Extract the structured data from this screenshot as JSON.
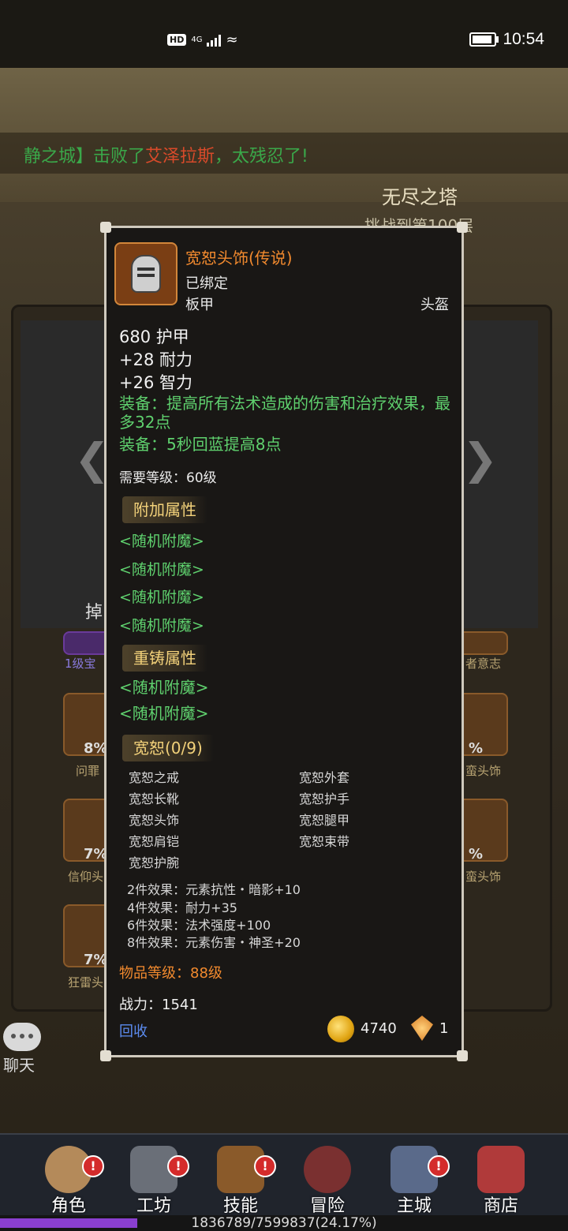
{
  "status_bar": {
    "time": "10:54",
    "hd": "HD",
    "network": "4G"
  },
  "background": {
    "ticker_prefix": "静之城】击败了",
    "ticker_name": "艾泽拉斯",
    "ticker_suffix": "，太残忍了!",
    "tower_title": "无尽之塔",
    "tower_sub": "挑战到第100层",
    "drop_tab": "掉",
    "left_slots": [
      "1级宝",
      "问罪",
      "信仰头",
      "狂雷头"
    ],
    "left_pcts": [
      "8%",
      "7%",
      "7%"
    ],
    "right_slots": [
      "者意志",
      "蛮头饰",
      "蛮头饰"
    ],
    "right_pcts": [
      "%",
      "%"
    ]
  },
  "chat": {
    "label": "聊天"
  },
  "item": {
    "name": "宽恕头饰(传说)",
    "bound": "已绑定",
    "armor_type": "板甲",
    "slot": "头盔",
    "stats": [
      "680 护甲",
      "+28 耐力",
      "+26 智力"
    ],
    "equip_effects": [
      "装备：提高所有法术造成的伤害和治疗效果，最多32点",
      "装备：5秒回蓝提高8点"
    ],
    "required_level": "需要等级：60级",
    "extra_attr_title": "附加属性",
    "extra_attrs": [
      "<随机附魔>",
      "<随机附魔>",
      "<随机附魔>",
      "<随机附魔>"
    ],
    "reforge_title": "重铸属性",
    "reforge_attrs": [
      "<随机附魔>",
      "<随机附魔>"
    ],
    "set_title": "宽恕(0/9)",
    "set_items_left": [
      "宽恕之戒",
      "宽恕长靴",
      "宽恕头饰",
      "宽恕肩铠",
      "宽恕护腕"
    ],
    "set_items_right": [
      "宽恕外套",
      "宽恕护手",
      "宽恕腿甲",
      "宽恕束带"
    ],
    "set_bonuses": [
      "2件效果：元素抗性・暗影+10",
      "4件效果：耐力+35",
      "6件效果：法术强度+100",
      "8件效果：元素伤害・神圣+20"
    ],
    "item_level": "物品等级：88级",
    "power": "战力：1541",
    "recycle": "回收",
    "gold": "4740",
    "gems": "1"
  },
  "nav": {
    "items": [
      "角色",
      "工坊",
      "技能",
      "冒险",
      "主城",
      "商店"
    ],
    "badge": "!"
  },
  "xp": {
    "text": "1836789/7599837(24.17%)",
    "fraction": 0.2417
  }
}
